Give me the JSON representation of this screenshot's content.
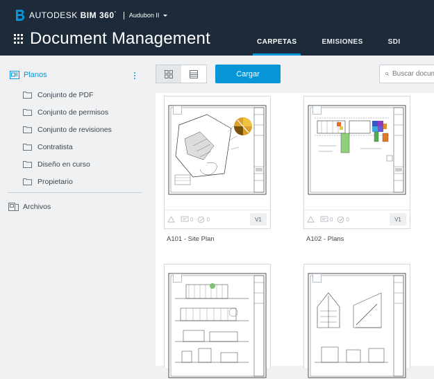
{
  "header": {
    "brand": "AUTODESK",
    "product": "BIM 360",
    "trademark": "°",
    "project": "Audubon II",
    "app_title": "Document Management",
    "tabs": [
      {
        "label": "CARPETAS",
        "active": true
      },
      {
        "label": "EMISIONES",
        "active": false
      },
      {
        "label": "SDI",
        "active": false
      }
    ]
  },
  "sidebar": {
    "root": {
      "label": "Planos",
      "icon": "plans-icon"
    },
    "folders": [
      {
        "label": "Conjunto de PDF"
      },
      {
        "label": "Conjunto de permisos"
      },
      {
        "label": "Conjunto de revisiones"
      },
      {
        "label": "Contratista"
      },
      {
        "label": "Diseño en curso"
      },
      {
        "label": "Propietario"
      }
    ],
    "archivos": {
      "label": "Archivos",
      "icon": "files-icon"
    }
  },
  "toolbar": {
    "upload_label": "Cargar",
    "search_placeholder": "Buscar documentos"
  },
  "cards": [
    {
      "title": "A101 - Site Plan",
      "issues": "",
      "markups": "0",
      "reviews": "0",
      "version": "V1"
    },
    {
      "title": "A102 - Plans",
      "issues": "",
      "markups": "0",
      "reviews": "0",
      "version": "V1"
    },
    {
      "title": "",
      "issues": "",
      "markups": "",
      "reviews": "",
      "version": ""
    },
    {
      "title": "",
      "issues": "",
      "markups": "",
      "reviews": "",
      "version": ""
    }
  ],
  "colors": {
    "header_bg": "#1c2a3a",
    "accent": "#0696d7",
    "sidebar_bg": "#f0f1f3"
  }
}
